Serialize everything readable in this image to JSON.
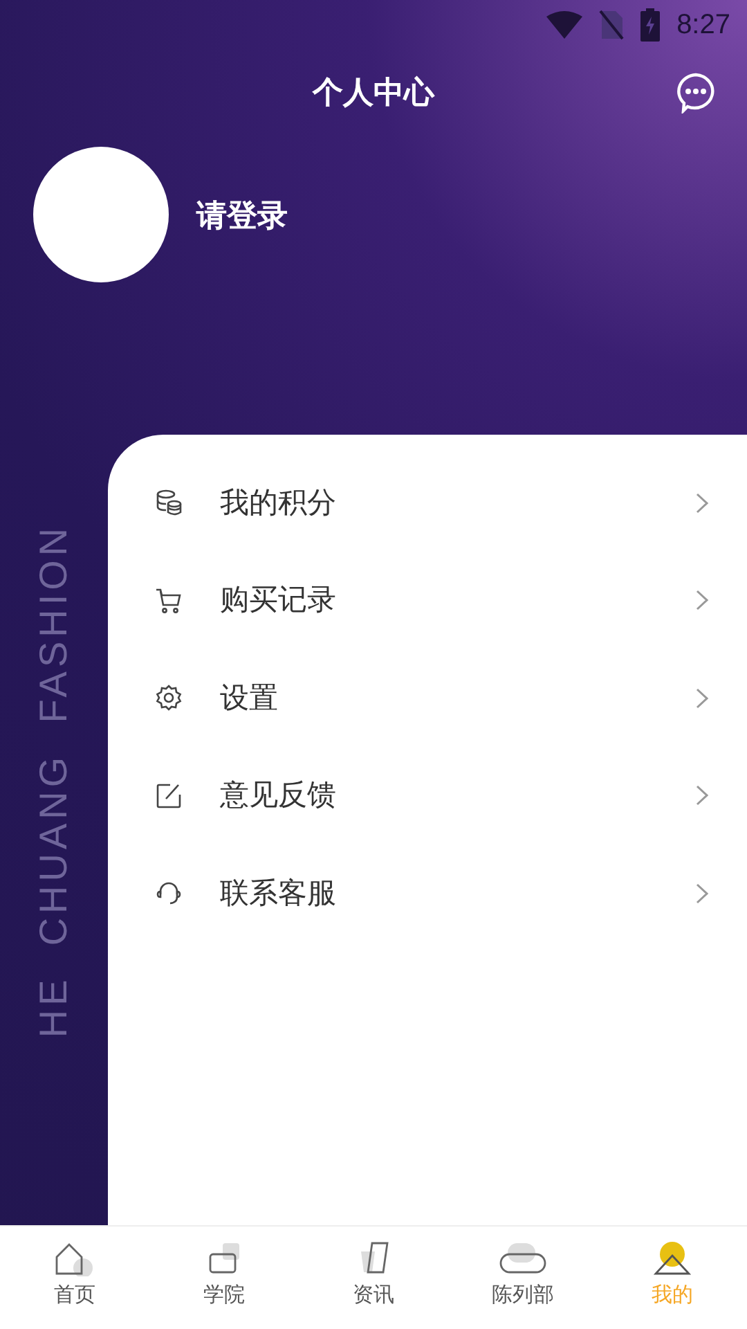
{
  "status_bar": {
    "time": "8:27"
  },
  "header": {
    "title": "个人中心"
  },
  "profile": {
    "login_text": "请登录"
  },
  "side_text": "HE  CHUANG  FASHION",
  "menu": [
    {
      "label": "我的积分"
    },
    {
      "label": "购买记录"
    },
    {
      "label": "设置"
    },
    {
      "label": "意见反馈"
    },
    {
      "label": "联系客服"
    }
  ],
  "tabs": [
    {
      "label": "首页",
      "selected": false
    },
    {
      "label": "学院",
      "selected": false
    },
    {
      "label": "资讯",
      "selected": false
    },
    {
      "label": "陈列部",
      "selected": false
    },
    {
      "label": "我的",
      "selected": true
    }
  ]
}
